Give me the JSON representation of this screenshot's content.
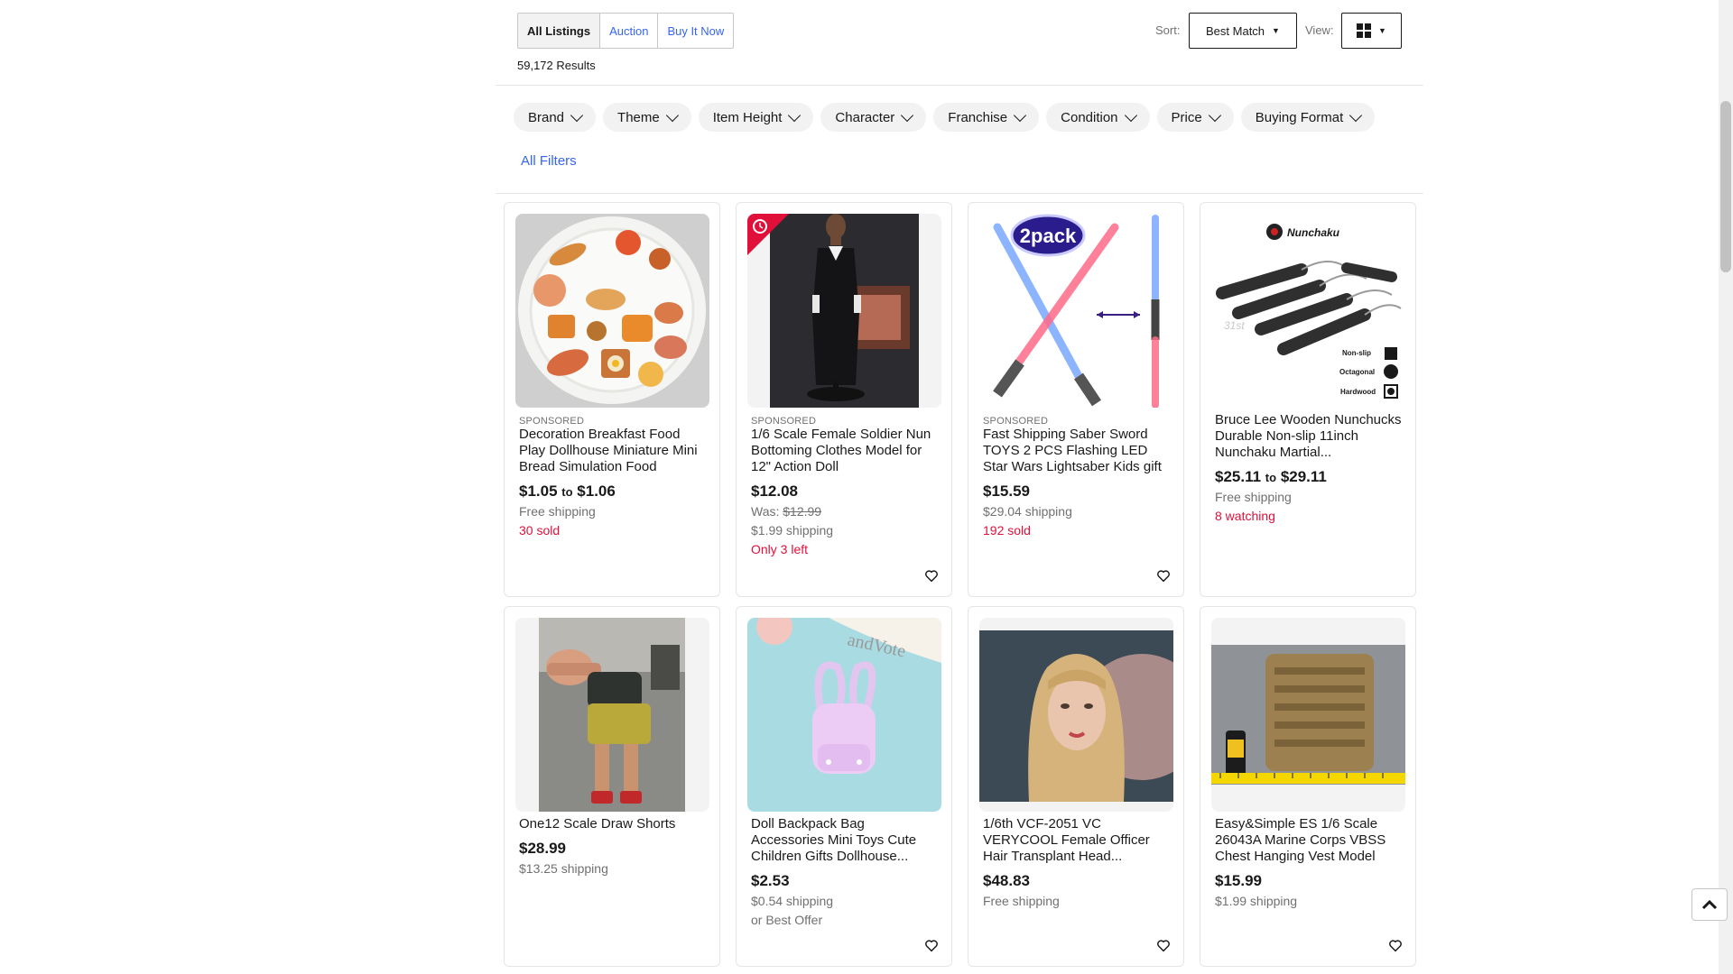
{
  "listing_tabs": [
    "All Listings",
    "Auction",
    "Buy It Now"
  ],
  "results_count": "59,172 Results",
  "sort": {
    "label": "Sort:",
    "value": "Best Match"
  },
  "view": {
    "label": "View:"
  },
  "filters": [
    "Brand",
    "Theme",
    "Item Height",
    "Character",
    "Franchise",
    "Condition",
    "Price",
    "Buying Format"
  ],
  "all_filters": "All Filters",
  "products": [
    {
      "sponsored": "SPONSORED",
      "title": "Decoration Breakfast Food Play Dollhouse Miniature Mini Bread Simulation Food",
      "price_from": "$1.05",
      "price_to_word": "to",
      "price_to": "$1.06",
      "shipping": "Free shipping",
      "note": "30 sold"
    },
    {
      "sponsored": "SPONSORED",
      "title": "1/6 Scale Female Soldier Nun Bottoming Clothes Model for 12\" Action Doll",
      "price": "$12.08",
      "was_label": "Was:",
      "was": "$12.99",
      "shipping": "$1.99 shipping",
      "note": "Only 3 left"
    },
    {
      "sponsored": "SPONSORED",
      "image_badge": "2pack",
      "title": "Fast Shipping Saber Sword TOYS 2 PCS Flashing LED Star Wars Lightsaber Kids gift",
      "price": "$15.59",
      "shipping": "$29.04 shipping",
      "note": "192 sold"
    },
    {
      "image_brand": "Nunchaku",
      "image_labels": [
        "Non-slip",
        "Octagonal",
        "Hardwood"
      ],
      "title": "Bruce Lee Wooden Nunchucks Durable Non-slip 11inch Nunchaku Martial...",
      "price_from": "$25.11",
      "price_to_word": "to",
      "price_to": "$29.11",
      "shipping": "Free shipping",
      "note": "8 watching"
    },
    {
      "title": "One12 Scale Draw Shorts",
      "price": "$28.99",
      "shipping": "$13.25 shipping"
    },
    {
      "title": "Doll Backpack Bag Accessories Mini Toys Cute Children Gifts Dollhouse...",
      "price": "$2.53",
      "shipping": "$0.54 shipping",
      "extra": "or Best Offer"
    },
    {
      "title": "1/6th VCF-2051 VC VERYCOOL Female Officer Hair Transplant Head...",
      "price": "$48.83",
      "shipping": "Free shipping"
    },
    {
      "title": "Easy&Simple ES 1/6 Scale 26043A Marine Corps VBSS Chest Hanging Vest Model",
      "price": "$15.99",
      "shipping": "$1.99 shipping"
    }
  ],
  "colors": {
    "link": "#3665f3",
    "red": "#e0103a",
    "muted": "#707070",
    "pill": "#f2f2f2"
  }
}
